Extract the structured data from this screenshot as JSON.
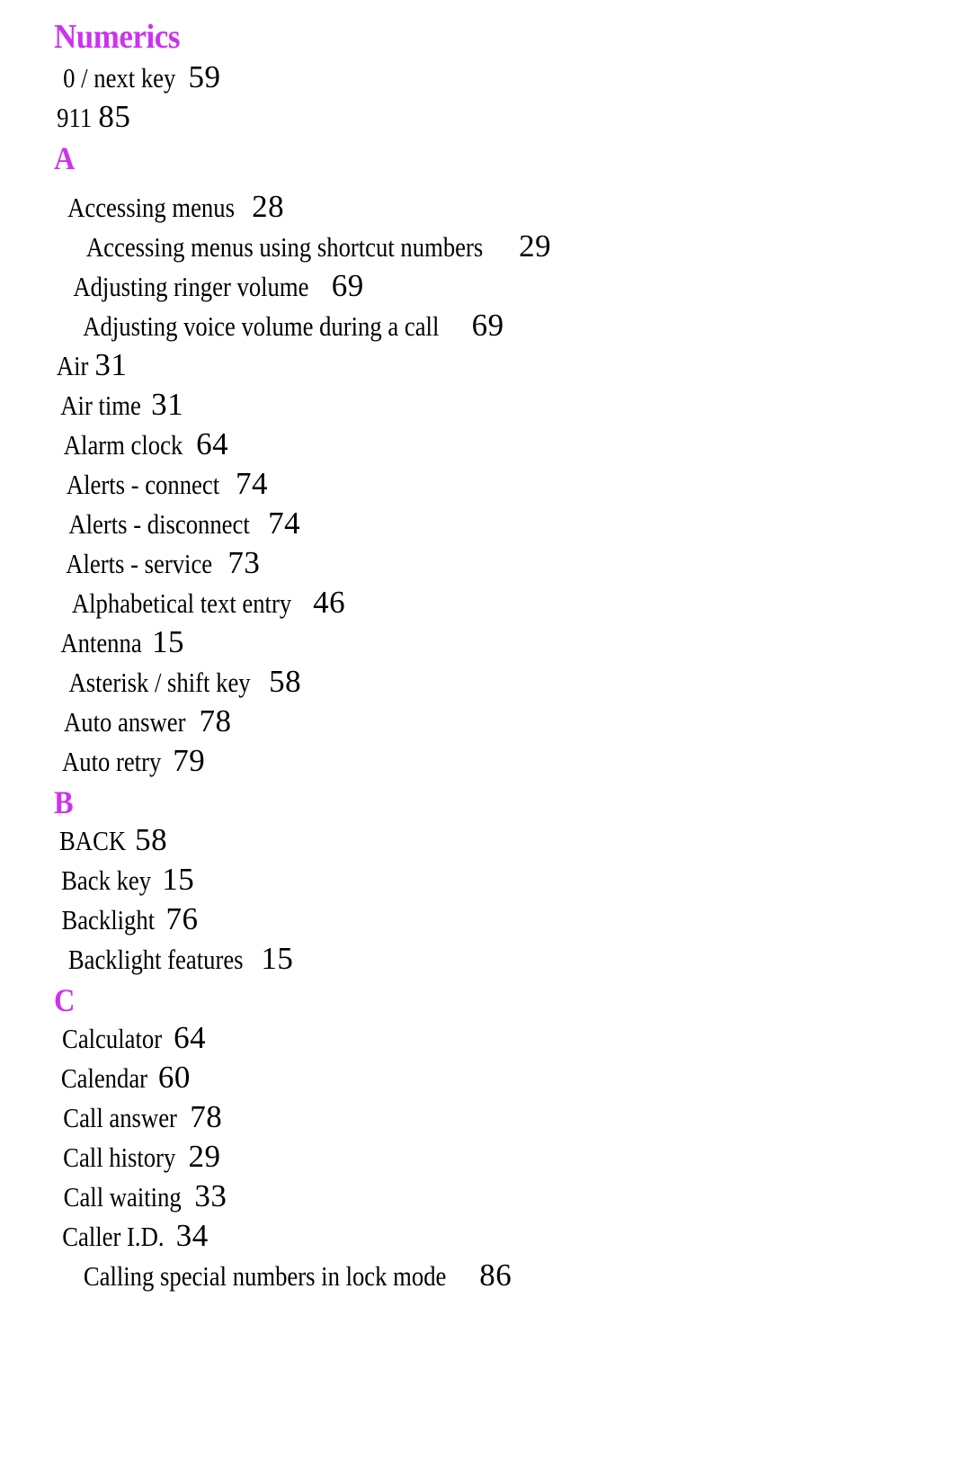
{
  "document": {
    "type": "book-index",
    "page_background": "#ffffff",
    "heading_color": "#cc33ee",
    "text_color": "#000000"
  },
  "sections": [
    {
      "id": "numerics",
      "heading": "Numerics",
      "heading_style": "word",
      "entries": [
        {
          "label": "0 / next key",
          "page": "59"
        },
        {
          "label": "911",
          "page": "85"
        }
      ]
    },
    {
      "id": "a",
      "heading": "A",
      "heading_style": "letter",
      "entries": [
        {
          "label": "Accessing menus",
          "page": "28"
        },
        {
          "label": "Accessing menus using shortcut numbers",
          "page": "29"
        },
        {
          "label": "Adjusting ringer volume",
          "page": "69"
        },
        {
          "label": "Adjusting voice volume during a call",
          "page": "69"
        },
        {
          "label": "Air",
          "page": "31"
        },
        {
          "label": "Air time",
          "page": "31"
        },
        {
          "label": "Alarm clock",
          "page": "64"
        },
        {
          "label": "Alerts - connect",
          "page": "74"
        },
        {
          "label": "Alerts - disconnect",
          "page": "74"
        },
        {
          "label": "Alerts - service",
          "page": "73"
        },
        {
          "label": "Alphabetical text entry",
          "page": "46"
        },
        {
          "label": "Antenna",
          "page": "15"
        },
        {
          "label": "Asterisk / shift key",
          "page": "58"
        },
        {
          "label": "Auto answer",
          "page": "78"
        },
        {
          "label": "Auto retry",
          "page": "79"
        }
      ]
    },
    {
      "id": "b",
      "heading": "B",
      "heading_style": "letter",
      "entries": [
        {
          "label": "BACK",
          "page": "58",
          "smallcaps": true
        },
        {
          "label": "Back key",
          "page": "15"
        },
        {
          "label": "Backlight",
          "page": "76"
        },
        {
          "label": "Backlight features",
          "page": "15"
        }
      ]
    },
    {
      "id": "c",
      "heading": "C",
      "heading_style": "letter",
      "entries": [
        {
          "label": "Calculator",
          "page": "64"
        },
        {
          "label": "Calendar",
          "page": "60"
        },
        {
          "label": "Call answer",
          "page": "78"
        },
        {
          "label": "Call history",
          "page": "29"
        },
        {
          "label": "Call waiting",
          "page": "33"
        },
        {
          "label": "Caller I.D.",
          "page": "34"
        },
        {
          "label": "Calling special numbers in lock mode",
          "page": "86"
        }
      ]
    }
  ]
}
